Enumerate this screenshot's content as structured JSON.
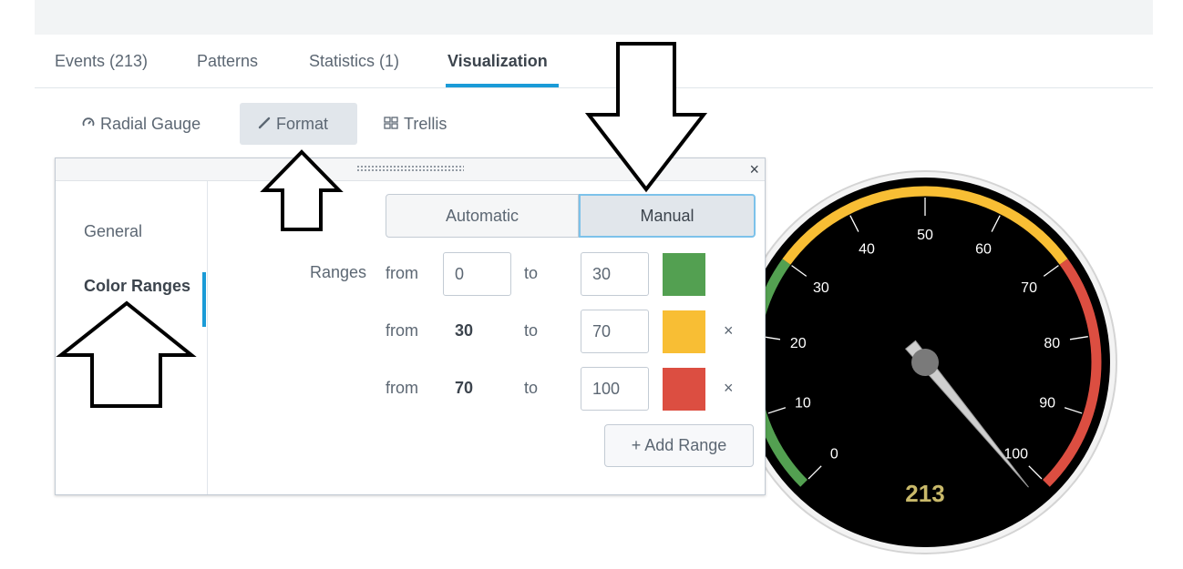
{
  "tabs": [
    {
      "label": "Events (213)"
    },
    {
      "label": "Patterns"
    },
    {
      "label": "Statistics (1)"
    },
    {
      "label": "Visualization"
    }
  ],
  "toolbar": {
    "viz_label": "Radial Gauge",
    "format_label": "Format",
    "trellis_label": "Trellis"
  },
  "panel": {
    "close": "×",
    "menu": [
      {
        "label": "General"
      },
      {
        "label": "Color Ranges"
      }
    ],
    "mode_auto": "Automatic",
    "mode_manual": "Manual",
    "ranges_label": "Ranges",
    "from_label": "from",
    "to_label": "to",
    "ranges": [
      {
        "from": "0",
        "to": "30",
        "color": "#53a051"
      },
      {
        "from": "30",
        "to": "70",
        "color": "#f8be34",
        "remove": "×"
      },
      {
        "from": "70",
        "to": "100",
        "color": "#dc4e41",
        "remove": "×"
      }
    ],
    "add_range": "+ Add Range"
  },
  "gauge": {
    "value": 213,
    "display_value": "213",
    "min": 0,
    "max": 100,
    "ticks": [
      "0",
      "10",
      "20",
      "30",
      "40",
      "50",
      "60",
      "70",
      "80",
      "90",
      "100"
    ],
    "value_color": "#c9b96a"
  }
}
